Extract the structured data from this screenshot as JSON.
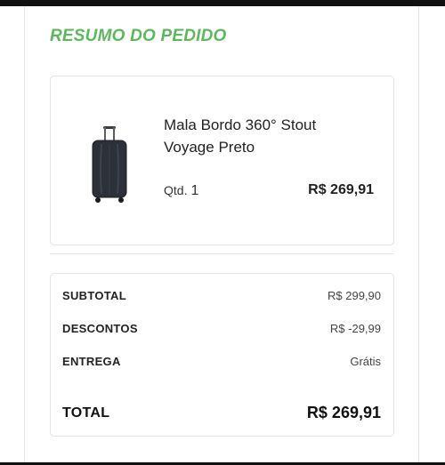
{
  "summary": {
    "title": "RESUMO DO PEDIDO",
    "accent_color": "#5cb85c"
  },
  "product": {
    "image_icon": "suitcase-icon",
    "name": "Mala Bordo 360° Stout Voyage Preto",
    "qty_label": "Qtd.",
    "qty_value": "1",
    "price": "R$ 269,91"
  },
  "totals": {
    "subtotal_label": "SUBTOTAL",
    "subtotal_value": "R$ 299,90",
    "discount_label": "DESCONTOS",
    "discount_value": "R$ -29,99",
    "shipping_label": "ENTREGA",
    "shipping_value": "Grátis",
    "total_label": "TOTAL",
    "total_value": "R$ 269,91"
  }
}
